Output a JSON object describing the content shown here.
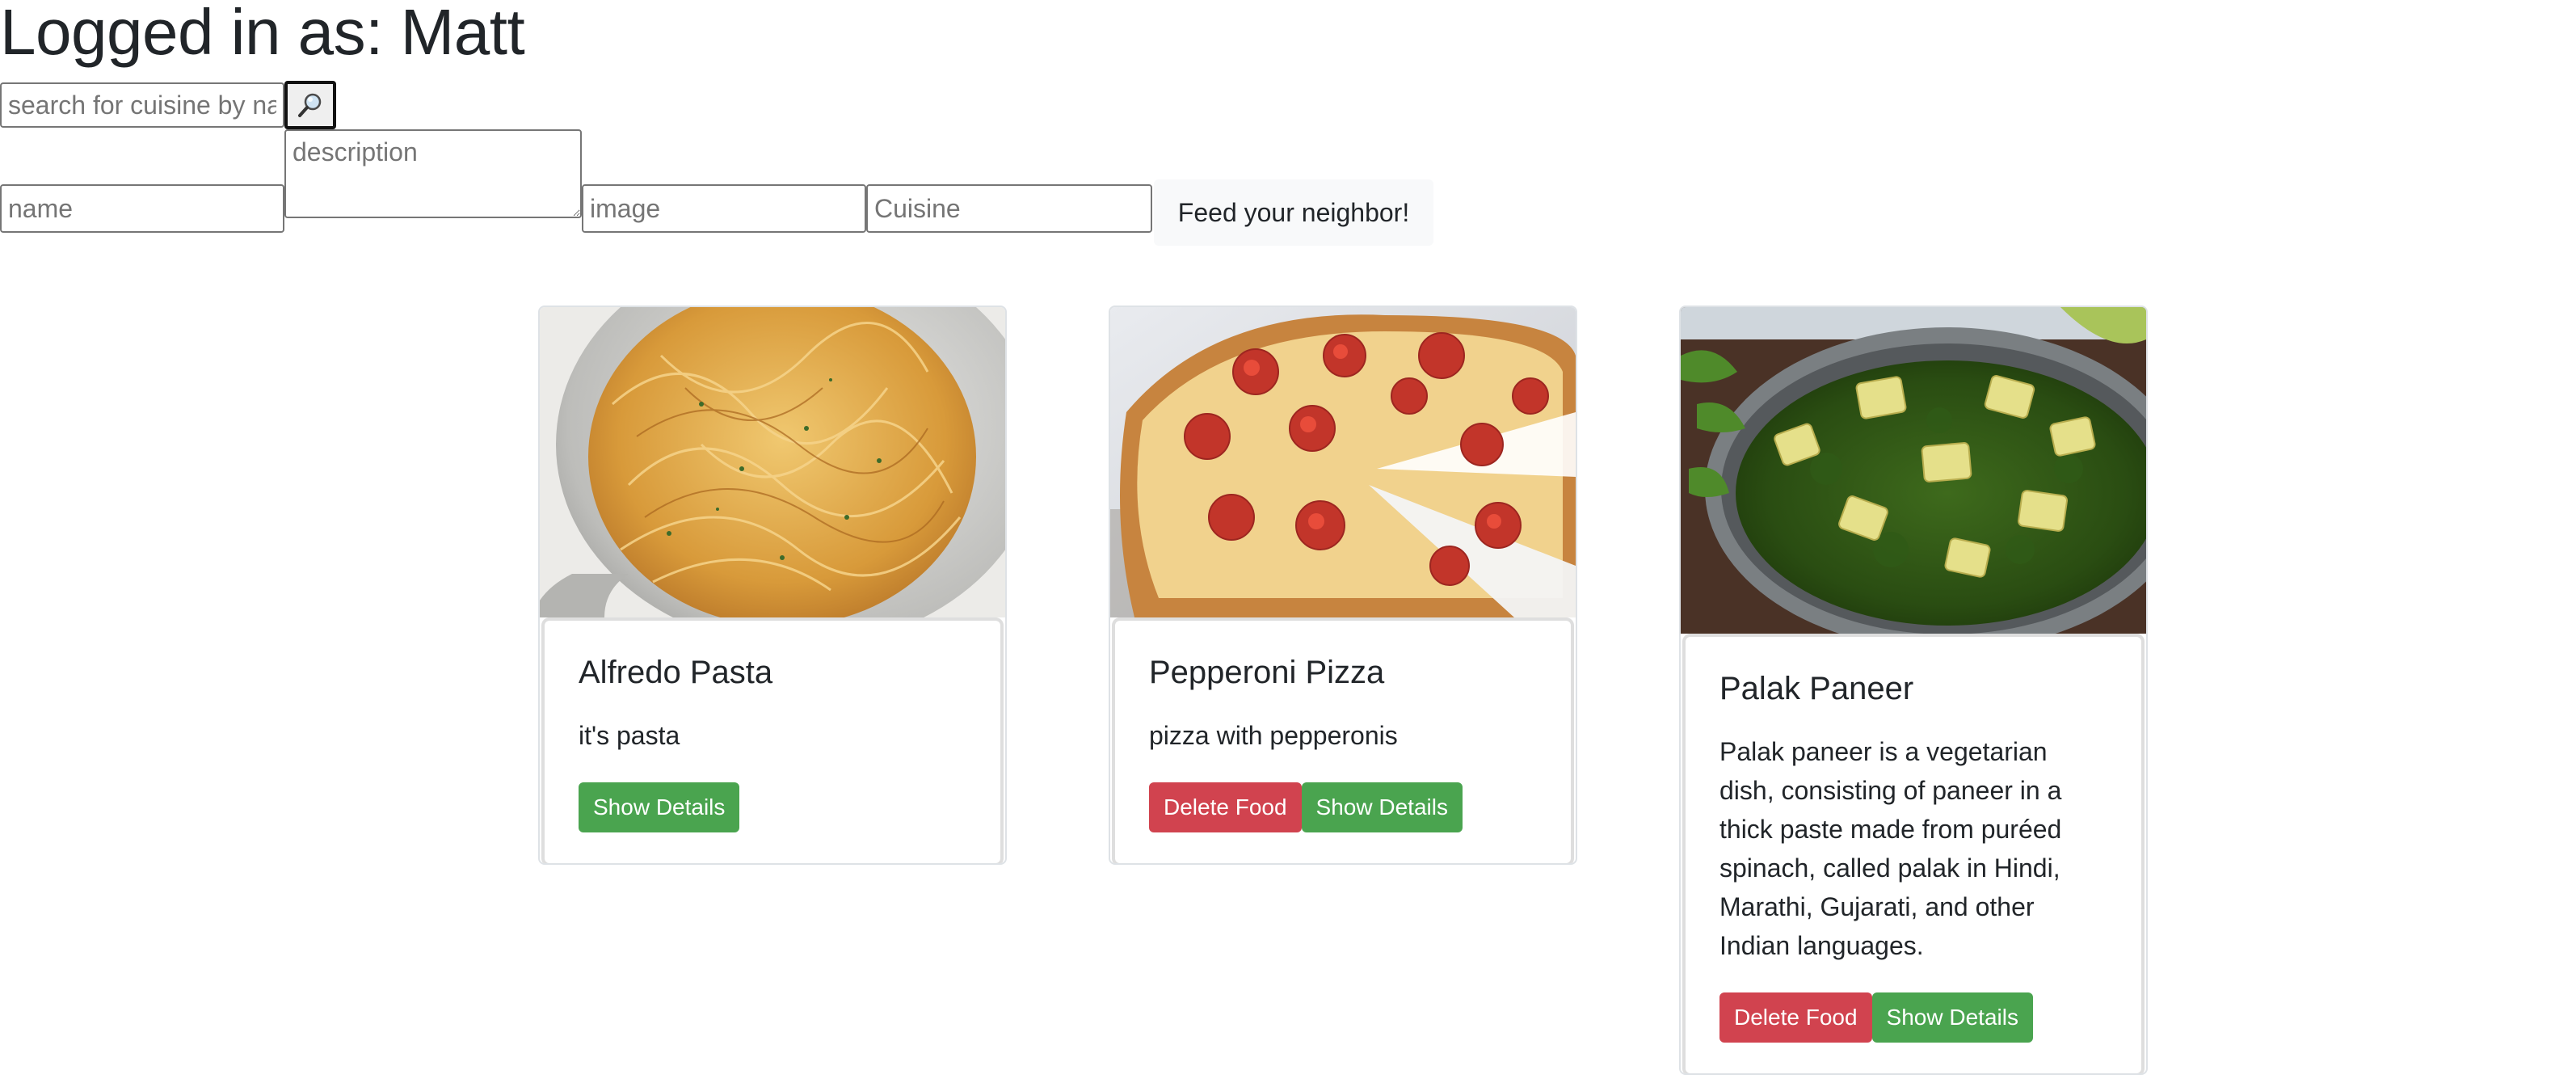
{
  "header": {
    "title": "Logged in as: Matt"
  },
  "search": {
    "placeholder": "search for cuisine by name",
    "button_icon": "magnifier-icon"
  },
  "form": {
    "name_placeholder": "name",
    "description_placeholder": "description",
    "image_placeholder": "image",
    "cuisine_placeholder": "Cuisine",
    "submit_label": "Feed your neighbor!"
  },
  "cards": [
    {
      "title": "Alfredo Pasta",
      "description": "it's pasta",
      "show_details_label": "Show Details",
      "image_alt": "plate of spaghetti"
    },
    {
      "title": "Pepperoni Pizza",
      "description": "pizza with pepperonis",
      "delete_label": "Delete Food",
      "show_details_label": "Show Details",
      "image_alt": "sliced pepperoni pizza"
    },
    {
      "title": "Palak Paneer",
      "description": "Palak paneer is a vegetarian dish, consisting of paneer in a thick paste made from puréed spinach, called palak in Hindi, Marathi, Gujarati, and other Indian languages.",
      "delete_label": "Delete Food",
      "show_details_label": "Show Details",
      "image_alt": "bowl of palak paneer"
    }
  ],
  "colors": {
    "danger": "#d1434f",
    "success": "#4aa44f",
    "text": "#212529"
  }
}
